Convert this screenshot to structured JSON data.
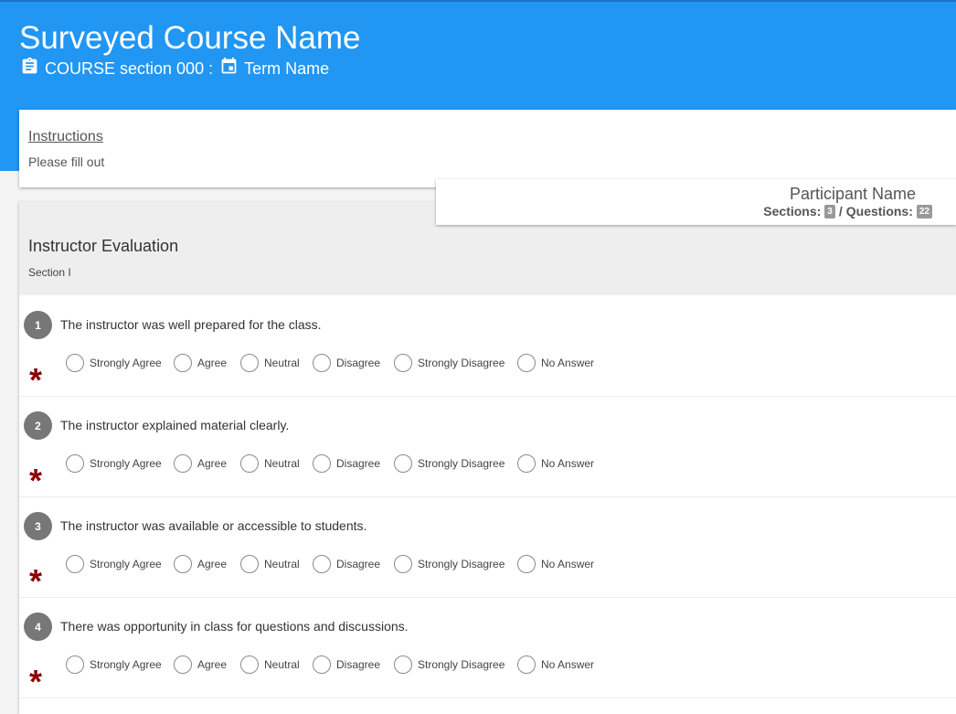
{
  "header": {
    "title": "Surveyed Course Name",
    "course": "COURSE section 000",
    "separator": ":",
    "term": "Term Name"
  },
  "instructions": {
    "title": "Instructions",
    "text": "Please fill out"
  },
  "participant": {
    "name": "Participant Name",
    "sections_label": "Sections:",
    "sections_count": "3",
    "divider": "/",
    "questions_label": "Questions:",
    "questions_count": "22"
  },
  "section": {
    "title": "Instructor Evaluation",
    "subtitle": "Section I"
  },
  "options": [
    "Strongly Agree",
    "Agree",
    "Neutral",
    "Disagree",
    "Strongly Disagree",
    "No Answer"
  ],
  "required_mark": "*",
  "questions": [
    {
      "number": "1",
      "text": "The instructor was well prepared for the class."
    },
    {
      "number": "2",
      "text": "The instructor explained material clearly."
    },
    {
      "number": "3",
      "text": "The instructor was available or accessible to students."
    },
    {
      "number": "4",
      "text": "There was opportunity in class for questions and discussions."
    }
  ],
  "colors": {
    "header": "#2196f3",
    "required": "#8b0000",
    "badge": "#777777"
  },
  "icons": {
    "course": "clipboard-icon",
    "term": "calendar-icon"
  }
}
